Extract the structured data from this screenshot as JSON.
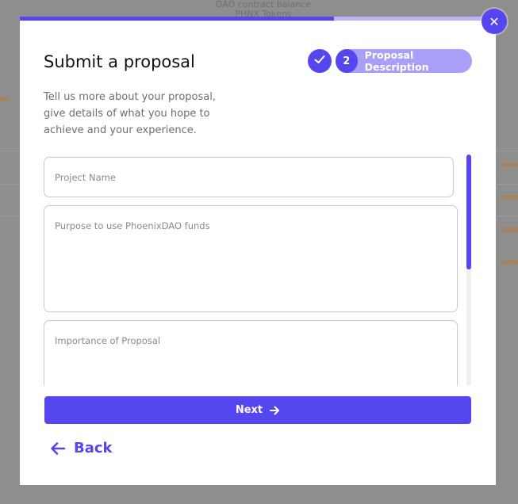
{
  "background": {
    "header_text": "DAO contract balance",
    "header_text_2": "PHNX Tokens"
  },
  "modal": {
    "title": "Submit a proposal",
    "subtitle": "Tell us more about your proposal, give details of what you hope to achieve and your experience.",
    "close_icon": "close-icon",
    "progress_fraction": 0.66
  },
  "steps": {
    "completed_icon": "check-icon",
    "current_number": "2",
    "current_label": "Proposal Description"
  },
  "form": {
    "project_name_placeholder": "Project Name",
    "purpose_placeholder": "Purpose to use PhoenixDAO funds",
    "importance_placeholder": "Importance of Proposal"
  },
  "actions": {
    "next_label": "Next",
    "back_label": "Back"
  },
  "colors": {
    "accent": "#5546f0",
    "accent_light": "#a99ff8",
    "overlay": "#8e8e8e"
  }
}
